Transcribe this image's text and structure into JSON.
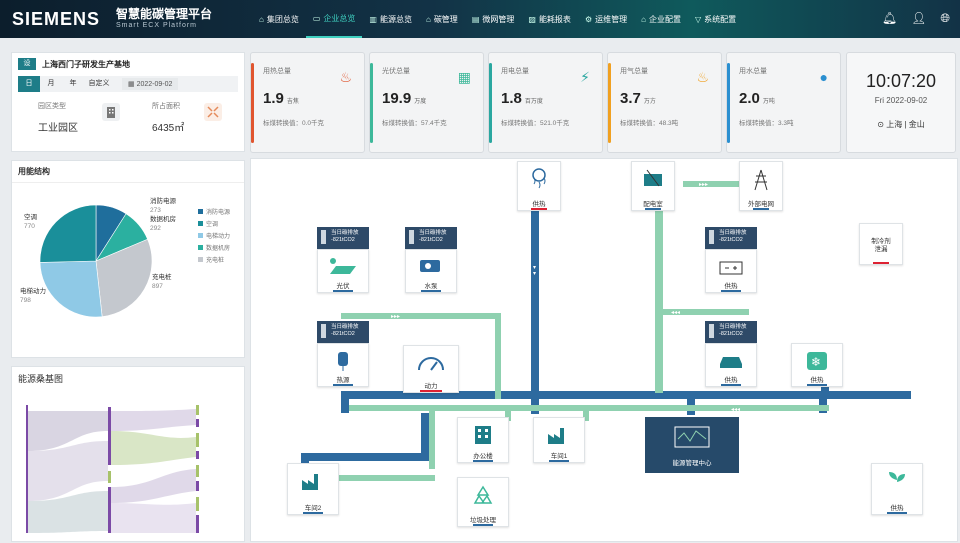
{
  "brand": {
    "logo": "SIEMENS",
    "title": "智慧能碳管理平台",
    "subtitle": "Smart ECX Platform"
  },
  "nav": [
    {
      "label": "集团总览",
      "icon": "home-icon",
      "glyph": "⌂"
    },
    {
      "label": "企业总览",
      "icon": "monitor-icon",
      "glyph": "▭"
    },
    {
      "label": "能源总览",
      "icon": "bars-icon",
      "glyph": "▥"
    },
    {
      "label": "碳管理",
      "icon": "factory-icon",
      "glyph": "⌂"
    },
    {
      "label": "微网管理",
      "icon": "grid-icon",
      "glyph": "▤"
    },
    {
      "label": "能耗报表",
      "icon": "chart-icon",
      "glyph": "▨"
    },
    {
      "label": "运维管理",
      "icon": "tools-icon",
      "glyph": "⚙"
    },
    {
      "label": "企业配置",
      "icon": "settings-icon",
      "glyph": "⌂"
    },
    {
      "label": "系统配置",
      "icon": "filter-icon",
      "glyph": "▽"
    }
  ],
  "site": {
    "icon_label": "设",
    "name": "上海西门子研发生产基地",
    "tabs": [
      "日",
      "月",
      "年",
      "自定义"
    ],
    "date": "2022-09-02",
    "park_type_label": "园区类型",
    "park_type": "工业园区",
    "area_label": "所占面积",
    "area": "6435㎡"
  },
  "energy_structure": {
    "title": "用能结构",
    "labels": [
      {
        "name": "消防电源",
        "value": "273"
      },
      {
        "name": "数据机房",
        "value": "292"
      },
      {
        "name": "空调",
        "value": "770"
      },
      {
        "name": "充电桩",
        "value": "897"
      },
      {
        "name": "电梯动力",
        "value": "798"
      }
    ]
  },
  "chart_data": {
    "type": "pie",
    "title": "用能结构",
    "categories": [
      "消防电源",
      "数据机房",
      "充电桩",
      "电梯动力",
      "空调"
    ],
    "values": [
      273,
      292,
      897,
      798,
      770
    ],
    "colors": [
      "#1f6e9c",
      "#2bb0a0",
      "#c4c8ce",
      "#8fc9e6",
      "#1a8f9a"
    ],
    "legend": [
      "消防电源",
      "空调",
      "电梯动力",
      "数据机房",
      "充电桩"
    ],
    "legend_placement": "right"
  },
  "sankey": {
    "title": "能源桑基图"
  },
  "kpis": [
    {
      "title": "用热总量",
      "value": "1.9",
      "unit": "吉焦",
      "conv": "标煤转换值：0.0千克",
      "color": "#e0552f",
      "icon": "thermometer-icon",
      "glyph": "🌡"
    },
    {
      "title": "光伏总量",
      "value": "19.9",
      "unit": "万度",
      "conv": "标煤转换值：57.4千克",
      "color": "#3db89a",
      "icon": "solar-panel-icon",
      "glyph": "▦"
    },
    {
      "title": "用电总量",
      "value": "1.8",
      "unit": "百万度",
      "conv": "标煤转换值：521.0千克",
      "color": "#2aa7a0",
      "icon": "power-tower-icon",
      "glyph": "⚡"
    },
    {
      "title": "用气总量",
      "value": "3.7",
      "unit": "万方",
      "conv": "标煤转换值：48.3吨",
      "color": "#f0a021",
      "icon": "flame-icon",
      "glyph": "🔥"
    },
    {
      "title": "用水总量",
      "value": "2.0",
      "unit": "万吨",
      "conv": "标煤转换值：3.3吨",
      "color": "#2a8fd0",
      "icon": "water-drop-icon",
      "glyph": "💧"
    }
  ],
  "clock": {
    "time": "10:07:20",
    "date": "Fri  2022-09-02",
    "location": "上海 | 金山"
  },
  "diagram": {
    "nodes": {
      "heating_top": "供热",
      "distribution": "配电室",
      "external_grid": "外部电网",
      "pv": "光伏",
      "pump": "水泵",
      "refrigerant": "制冷剂\n泄漏",
      "heating_right": "供热",
      "hot_water": "热源",
      "power": "动力",
      "car_heating": "供热",
      "cooling": "供热",
      "office": "办公楼",
      "workshop1": "车间1",
      "workshop2": "车间2",
      "center": "能源管理中心",
      "recycling": "垃圾处理",
      "plant": "供热"
    },
    "tag_text": "当日碳排放\n-821tCO2"
  }
}
